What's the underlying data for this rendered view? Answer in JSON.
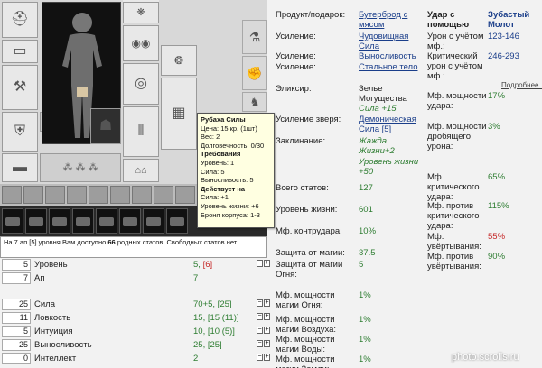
{
  "tooltip": {
    "title": "Рубаха Силы",
    "price": "Цена: 15 кр. (1шт)",
    "weight": "Вес: 2",
    "durability": "Долговечность: 0/30",
    "req_title": "Требования",
    "req_level": "Уровень: 1",
    "req_str": "Сила: 5",
    "req_end": "Выносливость: 5",
    "act_title": "Действует на",
    "act_str": "Сила: +1",
    "act_hp": "Уровень жизни: +6",
    "act_armor": "Броня корпуса: 1-3"
  },
  "info_line": {
    "prefix": "На 7 ап [5] уровня Вам доступно ",
    "count": "66",
    "suffix": " родных статов. Свободных статов нет."
  },
  "stats": [
    {
      "input": "5",
      "label": "Уровень",
      "value": "5, ",
      "extra_red": "[6]",
      "pm": true
    },
    {
      "input": "7",
      "label": "Ап",
      "value": "7",
      "extra_red": "",
      "pm": false
    },
    {
      "input": "25",
      "label": "Сила",
      "value": "70+5, [25]",
      "extra_red": "",
      "pm": true
    },
    {
      "input": "11",
      "label": "Ловкость",
      "value": "15, [15 (11)]",
      "extra_red": "",
      "pm": true
    },
    {
      "input": "5",
      "label": "Интуиция",
      "value": "10, [10 (5)]",
      "extra_red": "",
      "pm": true
    },
    {
      "input": "25",
      "label": "Выносливость",
      "value": "25, [25]",
      "extra_red": "",
      "pm": true
    },
    {
      "input": "0",
      "label": "Интеллект",
      "value": "2",
      "extra_red": "",
      "pm": true
    }
  ],
  "mid": {
    "product_lbl": "Продукт/подарок:",
    "product_val": "Бутерброд с мясом",
    "boost1_lbl": "Усиление:",
    "boost1_val": "Чудовищная Сила",
    "boost2_lbl": "Усиление:",
    "boost2_val": "Выносливость",
    "boost3_lbl": "Усиление:",
    "boost3_val": "Стальное тело",
    "elixir_lbl": "Эликсир:",
    "elixir_val": "Зелье Могущества",
    "elixir_bonus": "Сила +15",
    "beast_lbl": "Усиление зверя:",
    "beast_val": "Демоническая Сила [5]",
    "spell_lbl": "Заклинание:",
    "spell_val": "Жажда Жизни+2",
    "spell_bonus": "Уровень жизни +50",
    "total_lbl": "Всего статов:",
    "total_val": "127",
    "hp_lbl": "Уровень жизни:",
    "hp_val": "601",
    "counter_lbl": "Мф. контрудара:",
    "counter_val": "10%",
    "magdef_lbl": "Защита от магии:",
    "magdef_val": "37.5",
    "firedef_lbl": "Защита от магии Огня:",
    "firedef_val": "5",
    "fire_mf_lbl": "Мф. мощности магии Огня:",
    "fire_mf_val": "1%",
    "air_mf_lbl": "Мф. мощности магии Воздуха:",
    "air_mf_val": "1%",
    "water_mf_lbl": "Мф. мощности магии Воды:",
    "water_mf_val": "1%",
    "earth_mf_lbl": "Мф. мощности магии Земли:",
    "earth_mf_val": "1%"
  },
  "right": {
    "blow_lbl": "Удар с помощью",
    "weapon": "Зубастый Молот",
    "dmg_lbl": "Урон с учётом мф.:",
    "dmg_val": "123-146",
    "crit_lbl": "Критический урон с учётом мф.:",
    "crit_val": "246-293",
    "more": "Подробнее...",
    "mf_power_lbl": "Мф. мощности удара:",
    "mf_power_val": "17%",
    "mf_crush_lbl": "Мф. мощности дробящего урона:",
    "mf_crush_val": "3%",
    "mf_crit_lbl": "Мф. критического удара:",
    "mf_crit_val": "65%",
    "mf_anticrit_lbl": "Мф. против критического удара:",
    "mf_anticrit_val": "115%",
    "mf_dodge_lbl": "Мф. увёртывания:",
    "mf_dodge_val": "55%",
    "mf_antidodge_lbl": "Мф. против увёртывания:",
    "mf_antidodge_val": "90%"
  },
  "watermark": "photo.scrolls.ru"
}
